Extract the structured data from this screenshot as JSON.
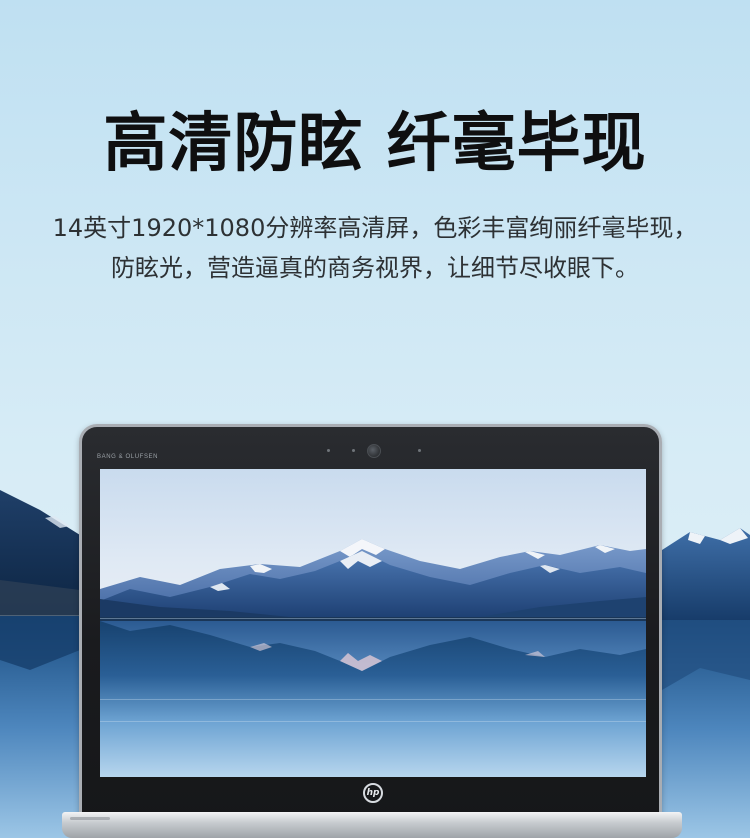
{
  "headline": "高清防眩 纤毫毕现",
  "subtitle": {
    "line1": "14英寸1920*1080分辨率高清屏，色彩丰富绚丽纤毫毕现，",
    "line2": "防眩光，营造逼真的商务视界，让细节尽收眼下。"
  },
  "laptop": {
    "bezel_brand": "BANG & OLUFSEN",
    "logo": "hp"
  },
  "colors": {
    "background_top": "#bfe0f2",
    "headline": "#0f0f10",
    "subtitle": "#2d3134",
    "bezel": "#1a1b1e",
    "mountain_blue": "#2f5fa0",
    "lake_dark": "#0b2c52"
  }
}
